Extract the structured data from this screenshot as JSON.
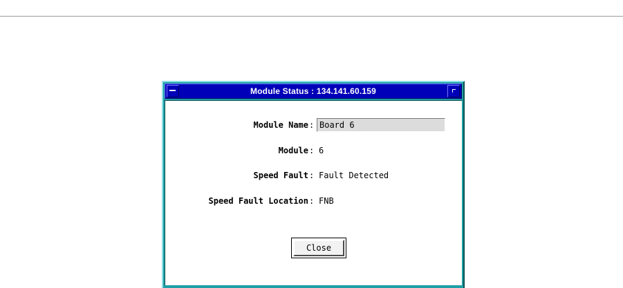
{
  "window": {
    "title": "Module Status : 134.141.60.159"
  },
  "fields": {
    "module_name": {
      "label": "Module Name",
      "value": "Board 6"
    },
    "module": {
      "label": "Module",
      "value": "6"
    },
    "speed_fault": {
      "label": "Speed Fault",
      "value": "Fault Detected"
    },
    "speed_fault_location": {
      "label": "Speed Fault Location",
      "value": "FNB"
    }
  },
  "separator": ":",
  "buttons": {
    "close_label": "Close"
  },
  "colors": {
    "title_bar": "#0000b8",
    "window_frame": "#1f9fa6",
    "field_background": "#dcdcdc"
  },
  "icons": {
    "window_menu": "window-menu-icon",
    "maximize": "maximize-icon"
  }
}
